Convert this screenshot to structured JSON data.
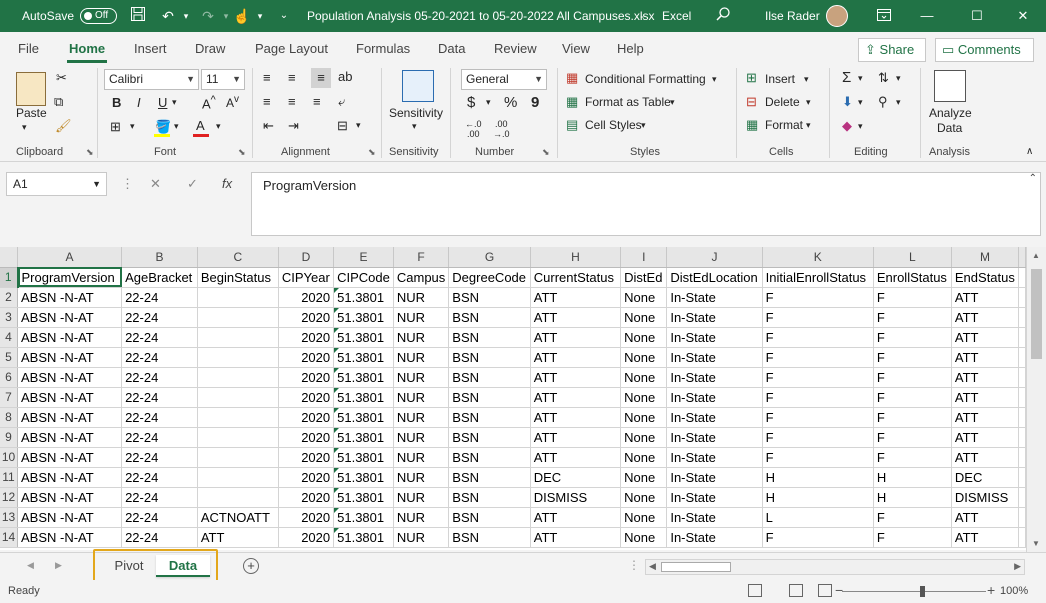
{
  "titlebar": {
    "autosave_label": "AutoSave",
    "autosave_state": "Off",
    "document_title": "Population Analysis 05-20-2021 to 05-20-2022 All Campuses.xlsx",
    "app_name": "Excel",
    "user_name": "Ilse Rader"
  },
  "menu": {
    "tabs": [
      "File",
      "Home",
      "Insert",
      "Draw",
      "Page Layout",
      "Formulas",
      "Data",
      "Review",
      "View",
      "Help"
    ],
    "share_label": "Share",
    "comments_label": "Comments"
  },
  "ribbon": {
    "clipboard": {
      "paste_label": "Paste",
      "group_label": "Clipboard"
    },
    "font": {
      "font_name": "Calibri",
      "font_size": "11",
      "bold": "B",
      "italic": "I",
      "underline": "U",
      "group_label": "Font"
    },
    "alignment": {
      "group_label": "Alignment"
    },
    "sensitivity": {
      "button_label": "Sensitivity",
      "group_label": "Sensitivity"
    },
    "number": {
      "format": "General",
      "currency": "$",
      "percent": "%",
      "comma": "9",
      "group_label": "Number"
    },
    "styles": {
      "conditional_formatting": "Conditional Formatting",
      "format_as_table": "Format as Table",
      "cell_styles": "Cell Styles",
      "group_label": "Styles"
    },
    "cells": {
      "insert": "Insert",
      "delete": "Delete",
      "format": "Format",
      "group_label": "Cells"
    },
    "editing": {
      "group_label": "Editing"
    },
    "analysis": {
      "analyze_line1": "Analyze",
      "analyze_line2": "Data",
      "group_label": "Analysis"
    }
  },
  "formula_bar": {
    "name_box": "A1",
    "fx": "fx",
    "content": "ProgramVersion"
  },
  "grid": {
    "column_letters": [
      "A",
      "B",
      "C",
      "D",
      "E",
      "F",
      "G",
      "H",
      "I",
      "J",
      "K",
      "L",
      "M"
    ],
    "row_numbers": [
      "1",
      "2",
      "3",
      "4",
      "5",
      "6",
      "7",
      "8",
      "9",
      "10",
      "11",
      "12",
      "13",
      "14"
    ],
    "header_row": [
      "ProgramVersion",
      "AgeBracket",
      "BeginStatus",
      "CIPYear",
      "CIPCode",
      "Campus",
      "DegreeCode",
      "CurrentStatus",
      "DistEd",
      "DistEdLocation",
      "InitialEnrollStatus",
      "EnrollStatus",
      "EndStatus"
    ],
    "rows": [
      [
        "ABSN -N-AT",
        "22-24",
        "",
        "2020",
        "51.3801",
        "NUR",
        "BSN",
        "ATT",
        "None",
        "In-State",
        "F",
        "F",
        "ATT"
      ],
      [
        "ABSN -N-AT",
        "22-24",
        "",
        "2020",
        "51.3801",
        "NUR",
        "BSN",
        "ATT",
        "None",
        "In-State",
        "F",
        "F",
        "ATT"
      ],
      [
        "ABSN -N-AT",
        "22-24",
        "",
        "2020",
        "51.3801",
        "NUR",
        "BSN",
        "ATT",
        "None",
        "In-State",
        "F",
        "F",
        "ATT"
      ],
      [
        "ABSN -N-AT",
        "22-24",
        "",
        "2020",
        "51.3801",
        "NUR",
        "BSN",
        "ATT",
        "None",
        "In-State",
        "F",
        "F",
        "ATT"
      ],
      [
        "ABSN -N-AT",
        "22-24",
        "",
        "2020",
        "51.3801",
        "NUR",
        "BSN",
        "ATT",
        "None",
        "In-State",
        "F",
        "F",
        "ATT"
      ],
      [
        "ABSN -N-AT",
        "22-24",
        "",
        "2020",
        "51.3801",
        "NUR",
        "BSN",
        "ATT",
        "None",
        "In-State",
        "F",
        "F",
        "ATT"
      ],
      [
        "ABSN -N-AT",
        "22-24",
        "",
        "2020",
        "51.3801",
        "NUR",
        "BSN",
        "ATT",
        "None",
        "In-State",
        "F",
        "F",
        "ATT"
      ],
      [
        "ABSN -N-AT",
        "22-24",
        "",
        "2020",
        "51.3801",
        "NUR",
        "BSN",
        "ATT",
        "None",
        "In-State",
        "F",
        "F",
        "ATT"
      ],
      [
        "ABSN -N-AT",
        "22-24",
        "",
        "2020",
        "51.3801",
        "NUR",
        "BSN",
        "ATT",
        "None",
        "In-State",
        "F",
        "F",
        "ATT"
      ],
      [
        "ABSN -N-AT",
        "22-24",
        "",
        "2020",
        "51.3801",
        "NUR",
        "BSN",
        "DEC",
        "None",
        "In-State",
        "H",
        "H",
        "DEC"
      ],
      [
        "ABSN -N-AT",
        "22-24",
        "",
        "2020",
        "51.3801",
        "NUR",
        "BSN",
        "DISMISS",
        "None",
        "In-State",
        "H",
        "H",
        "DISMISS"
      ],
      [
        "ABSN -N-AT",
        "22-24",
        "ACTNOATT",
        "2020",
        "51.3801",
        "NUR",
        "BSN",
        "ATT",
        "None",
        "In-State",
        "L",
        "F",
        "ATT"
      ],
      [
        "ABSN -N-AT",
        "22-24",
        "ATT",
        "2020",
        "51.3801",
        "NUR",
        "BSN",
        "ATT",
        "None",
        "In-State",
        "F",
        "F",
        "ATT"
      ]
    ]
  },
  "sheets": {
    "tabs": [
      "Pivot",
      "Data"
    ],
    "active": "Data"
  },
  "status": {
    "text": "Ready",
    "zoom": "100%"
  },
  "colors": {
    "accent": "#217346",
    "highlight": "#e3a71b"
  }
}
